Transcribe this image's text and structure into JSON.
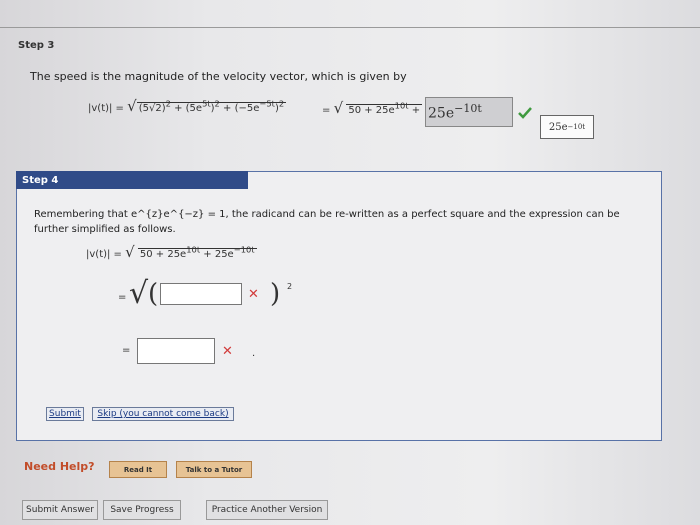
{
  "step3": {
    "label": "Step 3",
    "text": "The speed is the magnitude of the velocity vector, which is given by",
    "lhs": "|v(t)| =",
    "radicand": "(5√2)² + (5e^{5t})² + (−5e^{−5t})²",
    "equals": "=",
    "rhs_radicand": "50 + 25e",
    "rhs_exp": "10t",
    "rhs_plus": "+",
    "answer_value": "25e",
    "answer_exp": "−10t",
    "feedback_value": "25e",
    "feedback_exp": "−10t"
  },
  "step4": {
    "header": "Step 4",
    "text": "Remembering that e^{z}e^{−z} = 1, the radicand can be re-written as a perfect square and the expression can be further simplified as follows.",
    "lhs": "|v(t)| =",
    "radicand_base": "50 + 25e",
    "exp1": "10t",
    "plus": " + 25e",
    "exp2": "−10t",
    "equals": "=",
    "exponent": "2"
  },
  "buttons": {
    "submit": "Submit",
    "skip": "Skip (you cannot come back)"
  },
  "help": {
    "label": "Need Help?",
    "read": "Read It",
    "tutor": "Talk to a Tutor"
  },
  "bottom": {
    "submit_answer": "Submit Answer",
    "save_progress": "Save Progress",
    "practice": "Practice Another Version"
  },
  "colors": {
    "panel_header": "#304b88",
    "error": "#d23b3b",
    "check": "#3f9a3f"
  },
  "icons": {
    "check": "check-icon",
    "error": "x-icon"
  }
}
